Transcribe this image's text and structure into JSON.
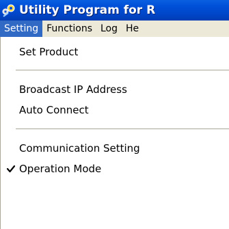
{
  "window": {
    "title": "Utility Program for R"
  },
  "menubar": {
    "items": [
      {
        "label": "Setting",
        "active": true
      },
      {
        "label": "Functions"
      },
      {
        "label": "Log"
      },
      {
        "label": "He"
      }
    ]
  },
  "dropdown": {
    "items": [
      {
        "label": "Set Product"
      },
      {
        "label": "Broadcast IP Address"
      },
      {
        "label": "Auto Connect"
      },
      {
        "label": "Communication Setting"
      },
      {
        "label": "Operation Mode",
        "checked": true
      }
    ]
  },
  "colors": {
    "titlebar": "#0050d8",
    "menubar_bg": "#ece9d8",
    "highlight": "#316ac5",
    "separator": "#aca899"
  }
}
